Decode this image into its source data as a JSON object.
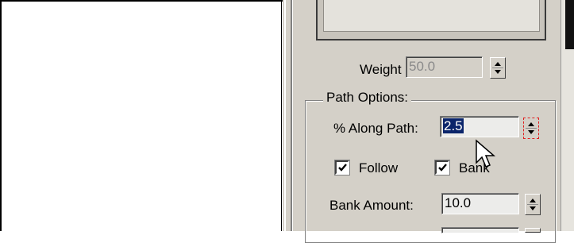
{
  "weight": {
    "label": "Weight",
    "value": "50.0"
  },
  "path_options": {
    "group_title": "Path Options:",
    "along_path": {
      "label": "% Along Path:",
      "value": "2.5"
    },
    "follow": {
      "label": "Follow",
      "checked": true
    },
    "bank": {
      "label": "Bank",
      "checked": true
    },
    "bank_amount": {
      "label": "Bank Amount:",
      "value": "10.0"
    }
  },
  "icons": {
    "spinner": "spinner-icon",
    "cursor": "mouse-pointer-icon",
    "check": "checkmark-icon"
  },
  "colors": {
    "panel": "#d4d0c8",
    "selection": "#0a246a",
    "spinner_focus": "#e02020"
  }
}
